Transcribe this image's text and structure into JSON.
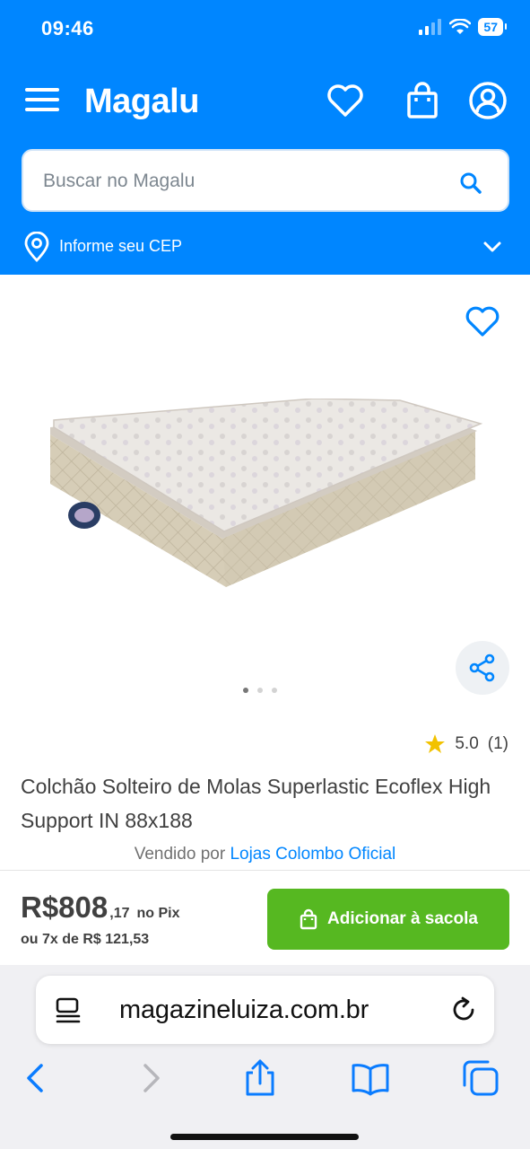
{
  "status_bar": {
    "time": "09:46",
    "battery": "57"
  },
  "header": {
    "logo_text": "Magalu",
    "search_placeholder": "Buscar no Magalu",
    "cep_label": "Informe seu CEP"
  },
  "product": {
    "rating_value": "5.0",
    "rating_count": "(1)",
    "title": "Colchão Solteiro de Molas Superlastic Ecoflex High Support IN 88x188",
    "seller_prefix": "Vendido por",
    "seller_name": "Lojas Colombo Oficial",
    "gallery_total": 3,
    "gallery_current": 1
  },
  "purchase": {
    "price_integer": "R$808",
    "price_cents": ",17",
    "pix_label": "no Pix",
    "installments": "ou 7x de R$ 121,53",
    "add_button_label": "Adicionar à sacola"
  },
  "browser": {
    "url": "magazineluiza.com.br"
  },
  "colors": {
    "brand_blue": "#0086ff",
    "buy_green": "#56b821",
    "star": "#f2c200"
  }
}
